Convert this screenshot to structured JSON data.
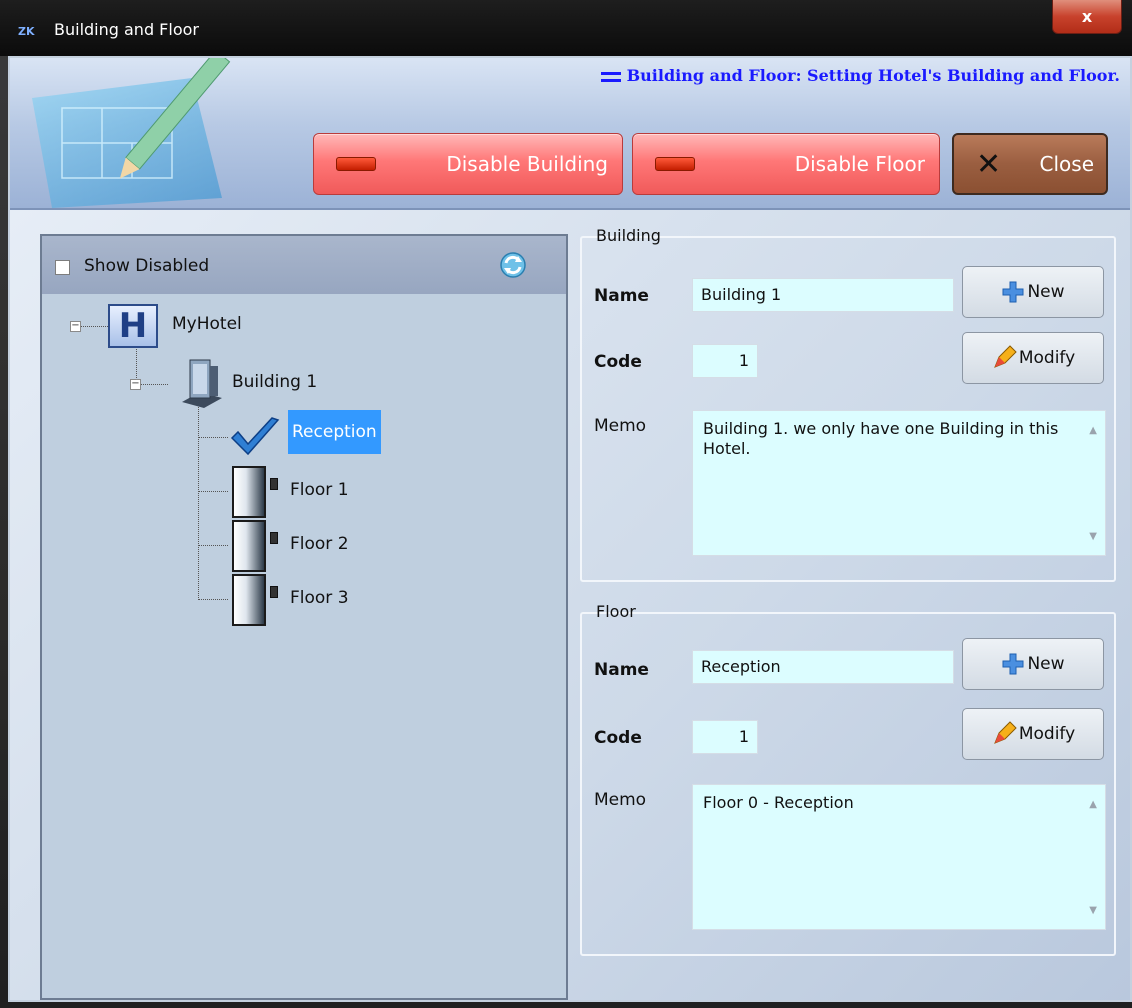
{
  "window": {
    "logo_text": "ZK",
    "title": "Building and Floor",
    "close_glyph": "x"
  },
  "banner": {
    "title": "Building and Floor: Setting Hotel's Building and Floor.",
    "disable_building_label": "Disable Building",
    "disable_floor_label": "Disable Floor",
    "close_label": "Close",
    "close_icon": "x-icon",
    "disable_icon": "minus-bar-icon",
    "accent_red": "#f05a5a",
    "accent_brown": "#9a5e40",
    "title_color": "#1a1aff"
  },
  "tree_panel": {
    "show_disabled_label": "Show Disabled",
    "show_disabled_checked": false,
    "refresh_icon": "refresh-icon",
    "nodes": [
      {
        "label": "MyHotel",
        "icon": "hotel-h-icon",
        "level": 0
      },
      {
        "label": "Building 1",
        "icon": "building-icon",
        "level": 1
      },
      {
        "label": "Reception",
        "icon": "checkmark-icon",
        "level": 2,
        "selected": true
      },
      {
        "label": "Floor 1",
        "icon": "floor-door-icon",
        "level": 2
      },
      {
        "label": "Floor 2",
        "icon": "floor-door-icon",
        "level": 2
      },
      {
        "label": "Floor 3",
        "icon": "floor-door-icon",
        "level": 2
      }
    ],
    "selected_color": "#3399ff"
  },
  "building": {
    "legend": "Building",
    "name_label": "Name",
    "name_value": "Building 1",
    "code_label": "Code",
    "code_value": "1",
    "memo_label": "Memo",
    "memo_value": "Building 1. we only have one Building in this Hotel.",
    "new_label": "New",
    "modify_label": "Modify"
  },
  "floor": {
    "legend": "Floor",
    "name_label": "Name",
    "name_value": "Reception",
    "code_label": "Code",
    "code_value": "1",
    "memo_label": "Memo",
    "memo_value": "Floor 0 - Reception",
    "new_label": "New",
    "modify_label": "Modify"
  }
}
